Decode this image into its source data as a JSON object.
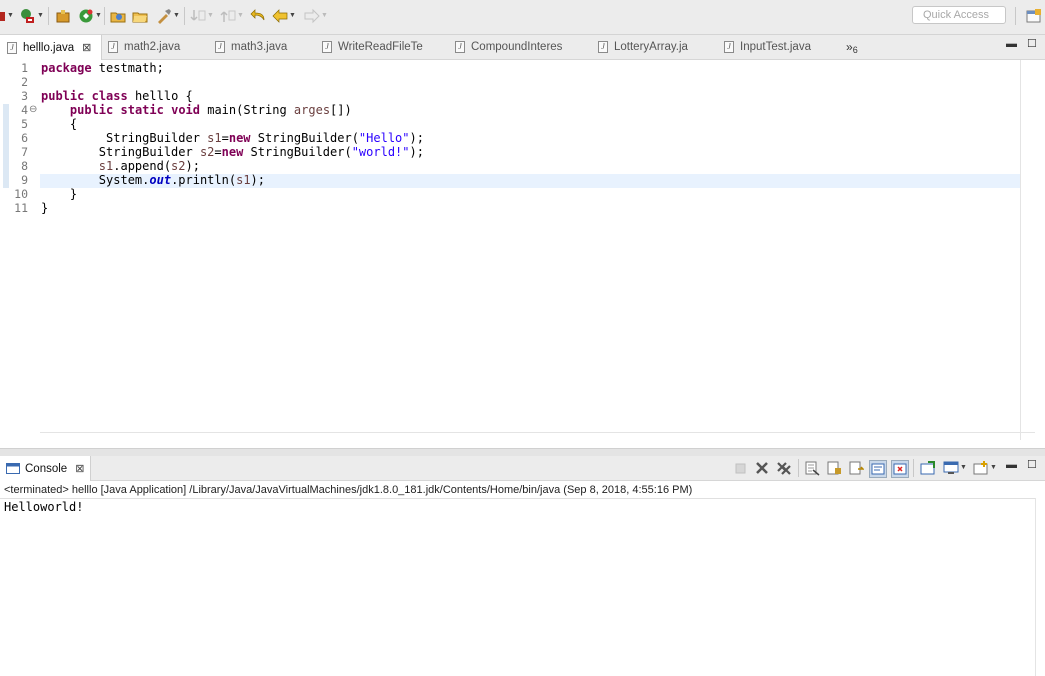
{
  "toolbar": {
    "quick_access_placeholder": "Quick Access",
    "icons": [
      "debug-icon",
      "run-icon",
      "new-package-icon",
      "coverage-icon",
      "open-type-icon",
      "open-folder-icon",
      "refactor-icon",
      "next-annotation-icon",
      "prev-annotation-icon",
      "last-edit-icon",
      "back-icon",
      "forward-icon",
      "perspective-icon"
    ]
  },
  "editor": {
    "tabs": [
      {
        "label": "helllo.java",
        "active": true
      },
      {
        "label": "math2.java"
      },
      {
        "label": "math3.java"
      },
      {
        "label": "WriteReadFileTe"
      },
      {
        "label": "CompoundInteres"
      },
      {
        "label": "LotteryArray.ja"
      },
      {
        "label": "InputTest.java"
      }
    ],
    "overflow": {
      "chevron": "»",
      "count": "6"
    },
    "line_numbers": [
      "1",
      "2",
      "3",
      "4",
      "5",
      "6",
      "7",
      "8",
      "9",
      "10",
      "11"
    ],
    "fold_marker": "⊖",
    "code": {
      "l1_kw": "package",
      "l1_rest": " testmath;",
      "l3_kw1": "public",
      "l3_kw2": "class",
      "l3_rest": " helllo {",
      "l4_indent": "    ",
      "l4_kw1": "public",
      "l4_kw2": "static",
      "l4_kw3": "void",
      "l4_mid": " main(String ",
      "l4_var": "arges",
      "l4_end": "[])",
      "l5": "    {",
      "l6_a": "         StringBuilder ",
      "l6_var": "s1",
      "l6_eq": "=",
      "l6_kw": "new",
      "l6_b": " StringBuilder(",
      "l6_str": "\"Hello\"",
      "l6_end": ");",
      "l7_a": "        StringBuilder ",
      "l7_var": "s2",
      "l7_eq": "=",
      "l7_kw": "new",
      "l7_b": " StringBuilder(",
      "l7_str": "\"world!\"",
      "l7_end": ");",
      "l8_a": "        ",
      "l8_var1": "s1",
      "l8_b": ".append(",
      "l8_var2": "s2",
      "l8_end": ");",
      "l9_a": "        System.",
      "l9_fld": "out",
      "l9_b": ".println(",
      "l9_var": "s1",
      "l9_end": ");",
      "l10": "    }",
      "l11": "}"
    }
  },
  "console": {
    "tab_label": "Console",
    "status": "<terminated> helllo [Java Application] /Library/Java/JavaVirtualMachines/jdk1.8.0_181.jdk/Contents/Home/bin/java (Sep 8, 2018, 4:55:16 PM)",
    "output": "Helloworld!"
  },
  "colors": {
    "keyword": "#7f0055",
    "string": "#2a00ff",
    "local_var": "#6a3e3e",
    "static_field": "#0000c0",
    "current_line": "#e8f2fe"
  }
}
